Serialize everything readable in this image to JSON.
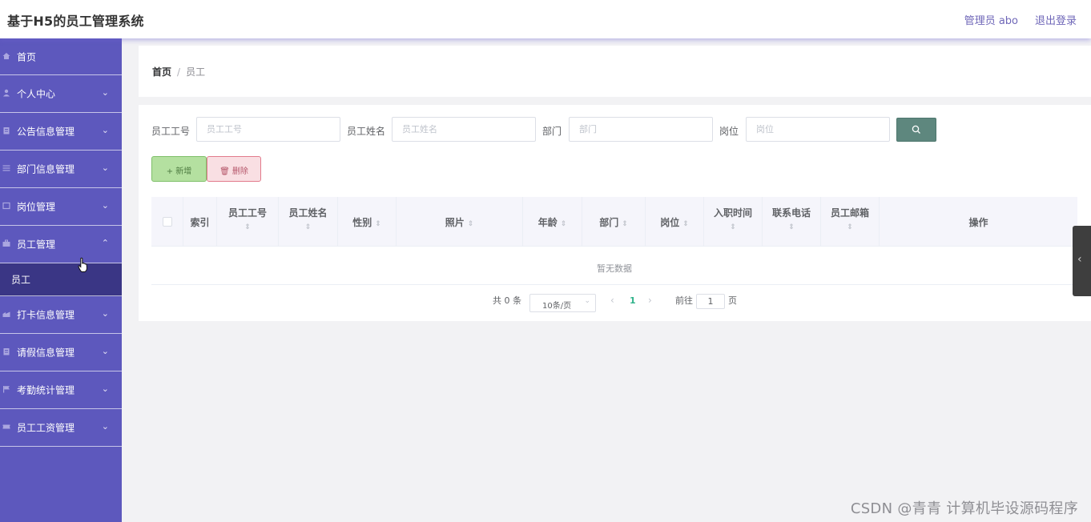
{
  "header": {
    "title": "基于H5的员工管理系统",
    "admin": "管理员 abo",
    "logout": "退出登录"
  },
  "sidebar": {
    "items": [
      {
        "label": "首页",
        "icon": "home-icon",
        "arrow": ""
      },
      {
        "label": "个人中心",
        "icon": "user-icon",
        "arrow": "⌄"
      },
      {
        "label": "公告信息管理",
        "icon": "notice-icon",
        "arrow": "⌄"
      },
      {
        "label": "部门信息管理",
        "icon": "list-icon",
        "arrow": "⌄"
      },
      {
        "label": "岗位管理",
        "icon": "post-icon",
        "arrow": "⌄"
      },
      {
        "label": "员工管理",
        "icon": "staff-icon",
        "arrow": "⌃"
      },
      {
        "label": "打卡信息管理",
        "icon": "clock-icon",
        "arrow": "⌄"
      },
      {
        "label": "请假信息管理",
        "icon": "leave-icon",
        "arrow": "⌄"
      },
      {
        "label": "考勤统计管理",
        "icon": "flag-icon",
        "arrow": "⌄"
      },
      {
        "label": "员工工资管理",
        "icon": "salary-icon",
        "arrow": "⌄"
      }
    ],
    "submenu": {
      "label": "员工"
    }
  },
  "breadcrumb": {
    "home": "首页",
    "separator": "/",
    "current": "员工"
  },
  "search": {
    "fields": [
      {
        "label": "员工工号",
        "placeholder": "员工工号"
      },
      {
        "label": "员工姓名",
        "placeholder": "员工姓名"
      },
      {
        "label": "部门",
        "placeholder": "部门"
      },
      {
        "label": "岗位",
        "placeholder": "岗位"
      }
    ],
    "button_icon": "search-icon"
  },
  "actions": {
    "add": "+ 新增",
    "delete": "🗑 删除"
  },
  "table": {
    "columns": [
      "索引",
      "员工工号",
      "员工姓名",
      "性别",
      "照片",
      "年龄",
      "部门",
      "岗位",
      "入职时间",
      "联系电话",
      "员工邮箱",
      "操作"
    ],
    "sort_glyph": "⇕",
    "empty_text": "暂无数据"
  },
  "pagination": {
    "total": "共 0 条",
    "page_size": "10条/页",
    "prev": "‹",
    "current_page": "1",
    "next": "›",
    "goto_label": "前往",
    "goto_value": "1",
    "goto_unit": "页"
  },
  "watermark": "CSDN @青青  计算机毕设源码程序",
  "colors": {
    "sidebar": "#5d58bd",
    "sidebar_active": "#3a3685",
    "search_button": "#5e877e",
    "add_button": "#b4e0a0",
    "delete_button": "#f9dfe3",
    "page_active": "#2fb28a"
  }
}
